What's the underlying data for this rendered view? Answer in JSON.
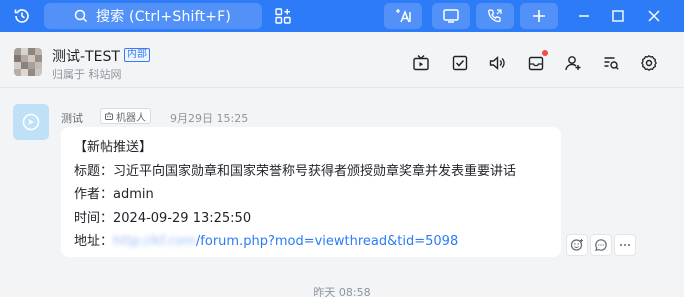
{
  "topbar": {
    "search_label": "搜索 (Ctrl+Shift+F)",
    "icons": [
      "history-icon",
      "search-icon",
      "apps-grid-icon",
      "ai-assistant-icon",
      "screen-share-icon",
      "phone-icon",
      "add-icon",
      "minimize-icon",
      "maximize-icon",
      "close-icon"
    ]
  },
  "chat": {
    "title": "测试-TEST",
    "badge": "内部",
    "subtitle": "归属于 科站网",
    "header_icons": [
      "live-tv-icon",
      "task-check-icon",
      "announcement-icon",
      "inbox-icon",
      "add-member-icon",
      "search-history-icon",
      "settings-icon"
    ]
  },
  "message": {
    "sender": "测试",
    "role_tag": "机器人",
    "time": "9月29日 15:25",
    "lines": {
      "heading": "【新帖推送】",
      "title_label": "标题：",
      "title_value": "习近平向国家勋章和国家荣誉称号获得者颁授勋章奖章并发表重要讲话",
      "author_label": "作者：",
      "author_value": "admin",
      "time_label": "时间：",
      "time_value": "2024-09-29 13:25:50",
      "url_label": "地址：",
      "url_blurred": "http://kf.com",
      "url_path": "/forum.php?mod=viewthread&tid=5098"
    }
  },
  "divider": {
    "text": "昨天 08:58"
  },
  "colors": {
    "topbar": "#2d7bf7",
    "accent": "#3a7cf0",
    "notification_dot": "#f54a45"
  }
}
